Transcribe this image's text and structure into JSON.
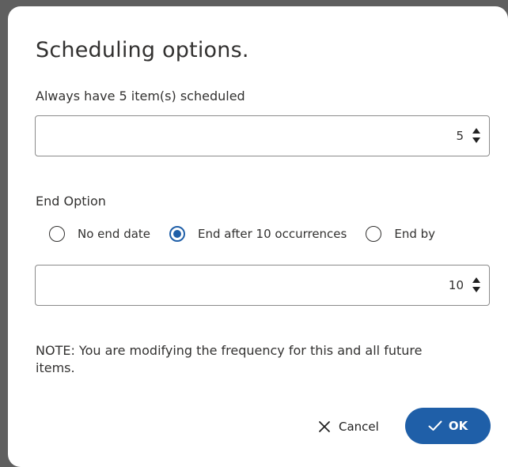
{
  "dialog": {
    "title": "Scheduling options.",
    "always_label": "Always have 5 item(s) scheduled",
    "scheduled_count": "5",
    "end_option_label": "End Option",
    "radios": [
      {
        "label": "No end date",
        "checked": false
      },
      {
        "label": "End after 10 occurrences",
        "checked": true
      },
      {
        "label": "End by",
        "checked": false
      }
    ],
    "occurrences": "10",
    "note": "NOTE: You are modifying the frequency for this and all future items.",
    "cancel_label": "Cancel",
    "ok_label": "OK"
  },
  "colors": {
    "accent": "#1f5fa8",
    "backdrop": "#5f5f5f"
  },
  "icons": [
    "close-icon",
    "check-icon",
    "spin-up-icon",
    "spin-down-icon",
    "radio-icon"
  ]
}
